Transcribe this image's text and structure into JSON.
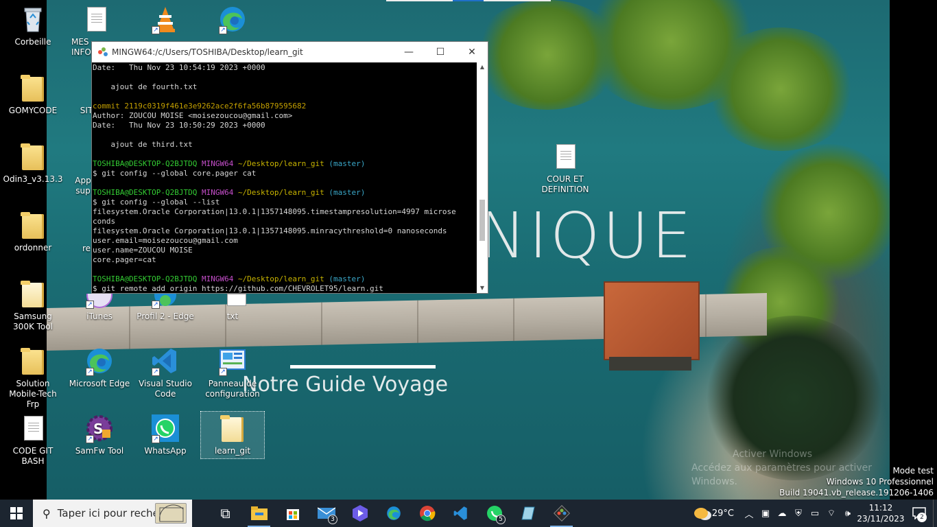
{
  "desktop_icons": [
    {
      "label": "Corbeille",
      "icon": "recycle-bin-icon"
    },
    {
      "label": "MES INFO",
      "icon": "document-icon"
    },
    {
      "label": "",
      "icon": "vlc-icon"
    },
    {
      "label": "",
      "icon": "edge-icon"
    },
    {
      "label": "GOMYCODE",
      "icon": "folder-icon"
    },
    {
      "label": "SIT",
      "icon": "document-icon"
    },
    {
      "label": "Odin3_v3.13.3",
      "icon": "folder-icon"
    },
    {
      "label": "App sup",
      "icon": "app-icon"
    },
    {
      "label": "ordonner",
      "icon": "folder-icon"
    },
    {
      "label": "re",
      "icon": "app-icon"
    },
    {
      "label": "Samsung 300K Tool",
      "icon": "folder-icon"
    },
    {
      "label": "iTunes",
      "icon": "itunes-icon"
    },
    {
      "label": "Profil 2 - Edge",
      "icon": "edge-profile-icon"
    },
    {
      "label": "txt",
      "icon": "text-file-icon"
    },
    {
      "label": "Solution Mobile-Tech Frp",
      "icon": "folder-icon"
    },
    {
      "label": "Microsoft Edge",
      "icon": "edge-icon"
    },
    {
      "label": "Visual Studio Code",
      "icon": "vscode-icon"
    },
    {
      "label": "Panneau de configuration",
      "icon": "control-panel-icon"
    },
    {
      "label": "CODE GIT BASH",
      "icon": "document-icon"
    },
    {
      "label": "SamFw Tool",
      "icon": "samfw-icon"
    },
    {
      "label": "WhatsApp",
      "icon": "whatsapp-icon"
    },
    {
      "label": "learn_git",
      "icon": "folder-icon"
    },
    {
      "label": "COUR ET DEFINITION",
      "icon": "document-icon"
    }
  ],
  "wallpaper": {
    "brand": "NIQUE",
    "tagline": "Notre Guide Voyage"
  },
  "watermark": {
    "line1": "Activer Windows",
    "line2": "Accédez aux paramètres pour activer Windows."
  },
  "terminal": {
    "title": "MINGW64:/c/Users/TOSHIBA/Desktop/learn_git",
    "lines": [
      {
        "segments": [
          {
            "t": "Date:   Thu Nov 23 10:54:19 2023 +0000",
            "c": ""
          }
        ]
      },
      {
        "segments": [
          {
            "t": "",
            "c": ""
          }
        ]
      },
      {
        "segments": [
          {
            "t": "    ajout de fourth.txt",
            "c": ""
          }
        ]
      },
      {
        "segments": [
          {
            "t": "",
            "c": ""
          }
        ]
      },
      {
        "segments": [
          {
            "t": "commit 2119c0319f461e3e9262ace2f6fa56b879595682",
            "c": "c-yellow"
          }
        ]
      },
      {
        "segments": [
          {
            "t": "Author: ZOUCOU MOISE <moisezoucou@gmail.com>",
            "c": ""
          }
        ]
      },
      {
        "segments": [
          {
            "t": "Date:   Thu Nov 23 10:50:29 2023 +0000",
            "c": ""
          }
        ]
      },
      {
        "segments": [
          {
            "t": "",
            "c": ""
          }
        ]
      },
      {
        "segments": [
          {
            "t": "    ajout de third.txt",
            "c": ""
          }
        ]
      },
      {
        "segments": [
          {
            "t": "",
            "c": ""
          }
        ]
      },
      {
        "segments": [
          {
            "t": "TOSHIBA@DESKTOP-Q2BJTDQ",
            "c": "c-green"
          },
          {
            "t": " ",
            "c": ""
          },
          {
            "t": "MINGW64",
            "c": "c-magenta"
          },
          {
            "t": " ",
            "c": ""
          },
          {
            "t": "~/Desktop/learn_git",
            "c": "c-gold"
          },
          {
            "t": " ",
            "c": ""
          },
          {
            "t": "(master)",
            "c": "c-cyan"
          }
        ]
      },
      {
        "segments": [
          {
            "t": "$ git config --global core.pager cat",
            "c": ""
          }
        ]
      },
      {
        "segments": [
          {
            "t": "",
            "c": ""
          }
        ]
      },
      {
        "segments": [
          {
            "t": "TOSHIBA@DESKTOP-Q2BJTDQ",
            "c": "c-green"
          },
          {
            "t": " ",
            "c": ""
          },
          {
            "t": "MINGW64",
            "c": "c-magenta"
          },
          {
            "t": " ",
            "c": ""
          },
          {
            "t": "~/Desktop/learn_git",
            "c": "c-gold"
          },
          {
            "t": " ",
            "c": ""
          },
          {
            "t": "(master)",
            "c": "c-cyan"
          }
        ]
      },
      {
        "segments": [
          {
            "t": "$ git config --global --list",
            "c": ""
          }
        ]
      },
      {
        "segments": [
          {
            "t": "filesystem.Oracle Corporation|13.0.1|1357148095.timestampresolution=4997 microse",
            "c": ""
          }
        ]
      },
      {
        "segments": [
          {
            "t": "conds",
            "c": ""
          }
        ]
      },
      {
        "segments": [
          {
            "t": "filesystem.Oracle Corporation|13.0.1|1357148095.minracythreshold=0 nanoseconds",
            "c": ""
          }
        ]
      },
      {
        "segments": [
          {
            "t": "user.email=moisezoucou@gmail.com",
            "c": ""
          }
        ]
      },
      {
        "segments": [
          {
            "t": "user.name=ZOUCOU MOISE",
            "c": ""
          }
        ]
      },
      {
        "segments": [
          {
            "t": "core.pager=cat",
            "c": ""
          }
        ]
      },
      {
        "segments": [
          {
            "t": "",
            "c": ""
          }
        ]
      },
      {
        "segments": [
          {
            "t": "TOSHIBA@DESKTOP-Q2BJTDQ",
            "c": "c-green"
          },
          {
            "t": " ",
            "c": ""
          },
          {
            "t": "MINGW64",
            "c": "c-magenta"
          },
          {
            "t": " ",
            "c": ""
          },
          {
            "t": "~/Desktop/learn_git",
            "c": "c-gold"
          },
          {
            "t": " ",
            "c": ""
          },
          {
            "t": "(master)",
            "c": "c-cyan"
          }
        ]
      },
      {
        "segments": [
          {
            "t": "$ git remote add origin https://github.com/CHEVROLET95/learn.git",
            "c": ""
          }
        ]
      }
    ],
    "buttons": {
      "minimize": "—",
      "maximize": "☐",
      "close": "✕"
    }
  },
  "taskbar": {
    "search_placeholder": "Taper ici pour rechercher",
    "apps": [
      {
        "name": "task-view",
        "glyph": "⧉",
        "badge": ""
      },
      {
        "name": "file-explorer",
        "glyph": "",
        "badge": ""
      },
      {
        "name": "microsoft-store",
        "glyph": "",
        "badge": ""
      },
      {
        "name": "mail",
        "glyph": "✉",
        "badge": "3"
      },
      {
        "name": "clipchamp",
        "glyph": "",
        "badge": ""
      },
      {
        "name": "edge",
        "glyph": "",
        "badge": ""
      },
      {
        "name": "chrome",
        "glyph": "",
        "badge": ""
      },
      {
        "name": "vscode",
        "glyph": "",
        "badge": ""
      },
      {
        "name": "whatsapp",
        "glyph": "",
        "badge": "5"
      },
      {
        "name": "notepad",
        "glyph": "",
        "badge": ""
      },
      {
        "name": "git-bash",
        "glyph": "",
        "badge": ""
      }
    ],
    "weather": "29°C",
    "time": "11:12",
    "date": "23/11/2023",
    "notifications": "2"
  },
  "system_info": {
    "line1": "Mode test",
    "line2": "Windows 10 Professionnel",
    "line3": "Build 19041.vb_release.191206-1406"
  }
}
